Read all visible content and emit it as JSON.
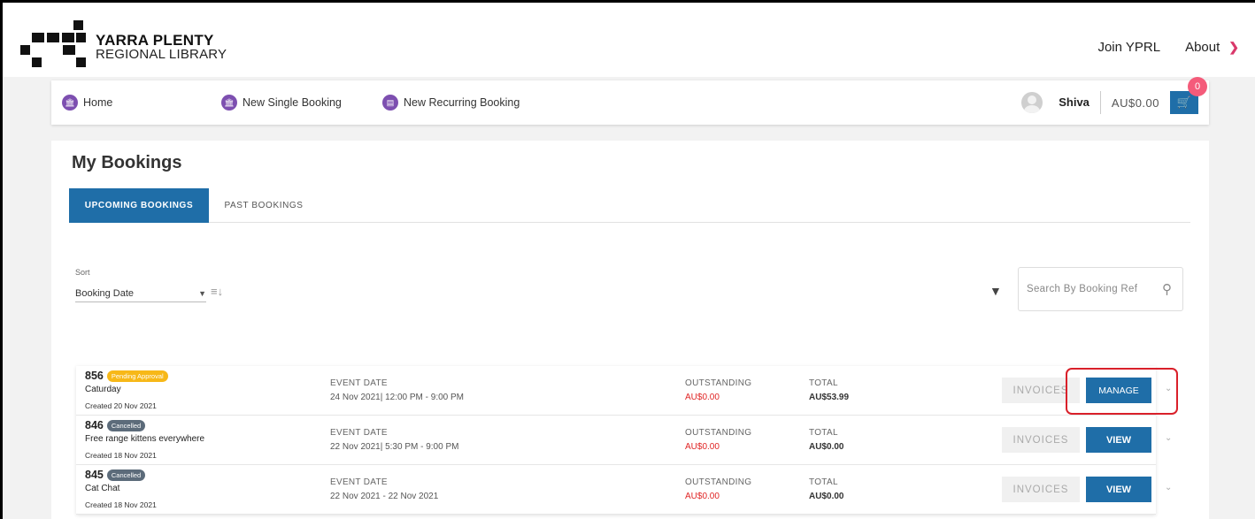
{
  "header": {
    "logo_line1": "YARRA PLENTY",
    "logo_line2": "REGIONAL LIBRARY",
    "nav": {
      "join": "Join YPRL",
      "about": "About"
    }
  },
  "navbar": {
    "home": "Home",
    "new_single": "New Single Booking",
    "new_recurring": "New Recurring Booking",
    "user_name": "Shiva",
    "balance": "AU$0.00",
    "cart_count": "0"
  },
  "page": {
    "title": "My Bookings",
    "tabs": [
      {
        "label": "UPCOMING BOOKINGS",
        "active": true
      },
      {
        "label": "PAST BOOKINGS",
        "active": false
      }
    ],
    "sort": {
      "label": "Sort",
      "value": "Booking Date"
    },
    "search": {
      "placeholder": "Search By Booking Ref"
    }
  },
  "bookings": [
    {
      "ref": "856",
      "status": "Pending Approval",
      "name": "Caturday",
      "created": "Created 20 Nov 2021",
      "event_label": "EVENT DATE",
      "event_date": "24 Nov 2021| 12:00 PM - 9:00 PM",
      "outstanding_label": "OUTSTANDING",
      "outstanding": "AU$0.00",
      "total_label": "TOTAL",
      "total": "AU$53.99",
      "invoices_label": "INVOICES",
      "action_label": "MANAGE"
    },
    {
      "ref": "846",
      "status": "Cancelled",
      "name": "Free range kittens everywhere",
      "created": "Created 18 Nov 2021",
      "event_label": "EVENT DATE",
      "event_date": "22 Nov 2021| 5:30 PM - 9:00 PM",
      "outstanding_label": "OUTSTANDING",
      "outstanding": "AU$0.00",
      "total_label": "TOTAL",
      "total": "AU$0.00",
      "invoices_label": "INVOICES",
      "action_label": "VIEW"
    },
    {
      "ref": "845",
      "status": "Cancelled",
      "name": "Cat Chat",
      "created": "Created 18 Nov 2021",
      "event_label": "EVENT DATE",
      "event_date": "22 Nov 2021 - 22 Nov 2021",
      "outstanding_label": "OUTSTANDING",
      "outstanding": "AU$0.00",
      "total_label": "TOTAL",
      "total": "AU$0.00",
      "invoices_label": "INVOICES",
      "action_label": "VIEW"
    }
  ],
  "colors": {
    "primary": "#1f6ea8",
    "accent_purple": "#7d4fb0",
    "pending": "#f7b818",
    "cancelled": "#5c6b7a",
    "outstanding_red": "#e02424",
    "highlight": "#d9202a"
  },
  "icons": {
    "home": "bank-icon",
    "single": "bank-icon",
    "recurring": "calendar-icon",
    "cart": "cart-icon",
    "filter": "filter-icon",
    "search": "search-icon",
    "sort_dir": "sort-direction-icon"
  }
}
